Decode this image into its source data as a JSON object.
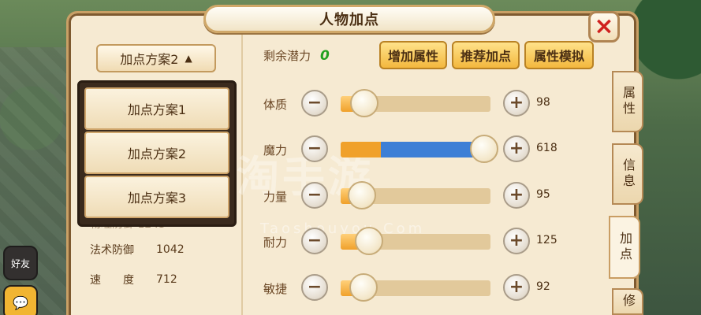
{
  "window": {
    "title": "人物加点",
    "close_icon": "×"
  },
  "scheme": {
    "selected": "加点方案2",
    "options": [
      "加点方案1",
      "加点方案2",
      "加点方案3"
    ]
  },
  "stats": {
    "partial": "物理防御 1243",
    "rows": [
      {
        "label": "法术防御",
        "value": "1042"
      },
      {
        "label": "速　　度",
        "value": "712"
      }
    ]
  },
  "potential": {
    "label": "剩余潜力",
    "value": "0"
  },
  "actions": {
    "add_attr": "增加属性",
    "recommend": "推荐加点",
    "simulate": "属性模拟"
  },
  "attributes": [
    {
      "label": "体质",
      "value": "98",
      "level": 0.16
    },
    {
      "label": "魔力",
      "value": "618",
      "level": 0.96
    },
    {
      "label": "力量",
      "value": "95",
      "level": 0.14
    },
    {
      "label": "耐力",
      "value": "125",
      "level": 0.19
    },
    {
      "label": "敏捷",
      "value": "92",
      "level": 0.15
    }
  ],
  "side_tabs": [
    "属性",
    "信息",
    "加点",
    "修"
  ],
  "side_buttons": [
    "好友",
    "聊天"
  ],
  "watermark": {
    "cn": "淘手游",
    "en": "Taoshouyou.Com"
  },
  "colors": {
    "accent": "#f3b83e",
    "potential_value": "#22a11f",
    "close": "#d0211e",
    "mana_fill": "#3d7fd6"
  }
}
